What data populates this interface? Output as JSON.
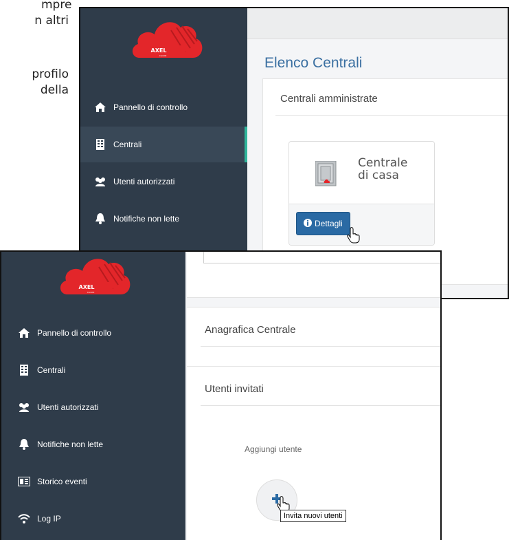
{
  "doc_fragments": {
    "line1": "mpre",
    "line2": "n altri",
    "line3": "profilo",
    "line4": "della"
  },
  "brand": {
    "logo_text": "AXEL",
    "logo_subtext": "CLOUD",
    "accent_color": "#2fb59b",
    "sidebar_color": "#2f3c4a",
    "logo_color": "#e3262a"
  },
  "sidebar_top": {
    "items": [
      {
        "label": "Pannello di controllo",
        "icon": "home-icon"
      },
      {
        "label": "Centrali",
        "icon": "building-icon",
        "active": true
      },
      {
        "label": "Utenti autorizzati",
        "icon": "users-icon"
      },
      {
        "label": "Notifiche non lette",
        "icon": "bell-icon"
      }
    ]
  },
  "sidebar_bottom": {
    "items": [
      {
        "label": "Pannello di controllo",
        "icon": "home-icon"
      },
      {
        "label": "Centrali",
        "icon": "building-icon"
      },
      {
        "label": "Utenti autorizzati",
        "icon": "users-icon"
      },
      {
        "label": "Notifiche non lette",
        "icon": "bell-icon"
      },
      {
        "label": "Storico eventi",
        "icon": "history-icon"
      },
      {
        "label": "Log IP",
        "icon": "wifi-icon"
      }
    ]
  },
  "centrali_page": {
    "title": "Elenco Centrali",
    "section_title": "Centrali amministrate",
    "card": {
      "name_line1": "Centrale",
      "name_line2": "di casa",
      "details_button": "Dettagli"
    }
  },
  "detail_page": {
    "anagrafica_title": "Anagrafica Centrale",
    "invited_title": "Utenti invitati",
    "add_user_label": "Aggiungi utente",
    "add_user_tooltip": "Invita nuovi utenti"
  }
}
